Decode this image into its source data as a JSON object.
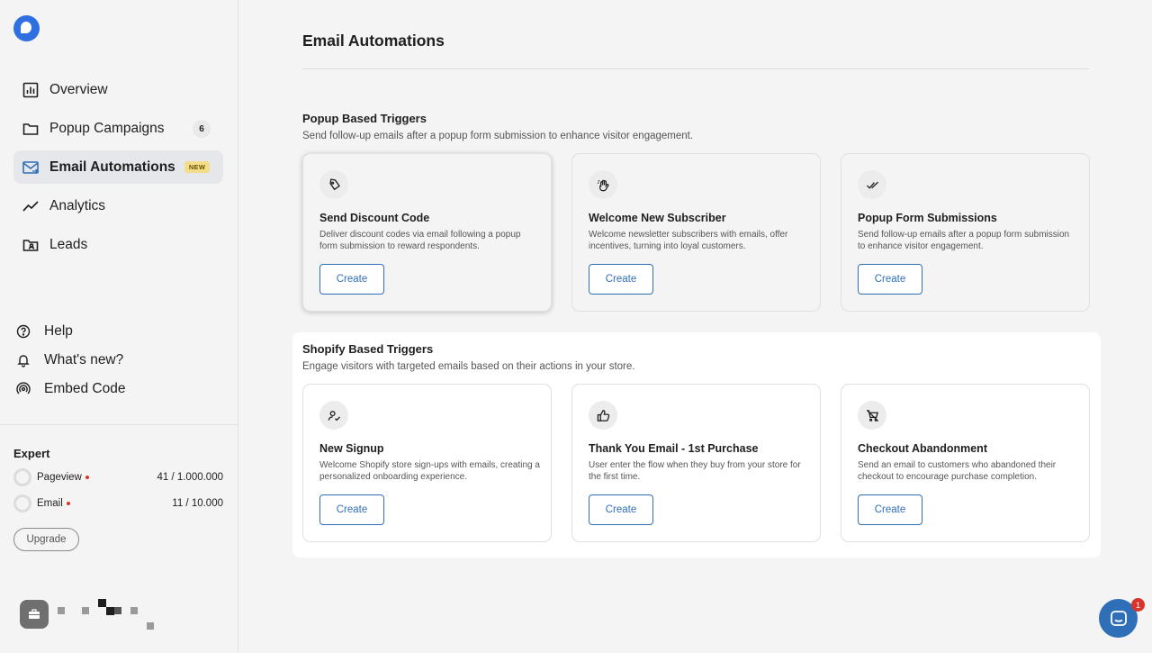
{
  "sidebar": {
    "nav": [
      {
        "label": "Overview",
        "icon": "chart-icon"
      },
      {
        "label": "Popup Campaigns",
        "icon": "folder-icon",
        "count": "6"
      },
      {
        "label": "Email Automations",
        "icon": "mail-icon",
        "badge": "NEW",
        "active": true
      },
      {
        "label": "Analytics",
        "icon": "trend-icon"
      },
      {
        "label": "Leads",
        "icon": "folder-user-icon"
      }
    ],
    "help": [
      {
        "label": "Help",
        "icon": "question-icon"
      },
      {
        "label": "What's new?",
        "icon": "bell-icon"
      },
      {
        "label": "Embed Code",
        "icon": "broadcast-icon"
      }
    ],
    "plan": {
      "title": "Expert",
      "usage": [
        {
          "label": "Pageview",
          "value": "41 / 1.000.000"
        },
        {
          "label": "Email",
          "value": "11 / 10.000"
        }
      ],
      "upgrade_label": "Upgrade"
    }
  },
  "main": {
    "title": "Email Automations",
    "popup_section": {
      "title": "Popup Based Triggers",
      "subtitle": "Send follow-up emails after a popup form submission to enhance visitor engagement.",
      "cards": [
        {
          "title": "Send Discount Code",
          "desc": "Deliver discount codes via email following a popup form submission to reward respondents.",
          "button": "Create",
          "icon": "tag-icon"
        },
        {
          "title": "Welcome New Subscriber",
          "desc": "Welcome newsletter subscribers with emails, offer incentives, turning into loyal customers.",
          "button": "Create",
          "icon": "wave-hand-icon"
        },
        {
          "title": "Popup Form Submissions",
          "desc": "Send follow-up emails after a popup form submission to enhance visitor engagement.",
          "button": "Create",
          "icon": "double-check-icon"
        }
      ]
    },
    "shopify_section": {
      "title": "Shopify Based Triggers",
      "subtitle": "Engage visitors with targeted emails based on their actions in your store.",
      "cards": [
        {
          "title": "New Signup",
          "desc": "Welcome Shopify store sign-ups with emails, creating a personalized onboarding experience.",
          "button": "Create",
          "icon": "user-check-icon"
        },
        {
          "title": "Thank You Email - 1st Purchase",
          "desc": "User enter the flow when they buy from your store for the first time.",
          "button": "Create",
          "icon": "thumbs-up-icon"
        },
        {
          "title": "Checkout Abandonment",
          "desc": "Send an email to customers who abandoned their checkout to encourage purchase completion.",
          "button": "Create",
          "icon": "cart-off-icon"
        }
      ]
    }
  },
  "chat": {
    "badge": "1"
  },
  "colors": {
    "accent": "#2f6fb8",
    "brand": "#2f6fe0",
    "badge_red": "#d9342b"
  }
}
